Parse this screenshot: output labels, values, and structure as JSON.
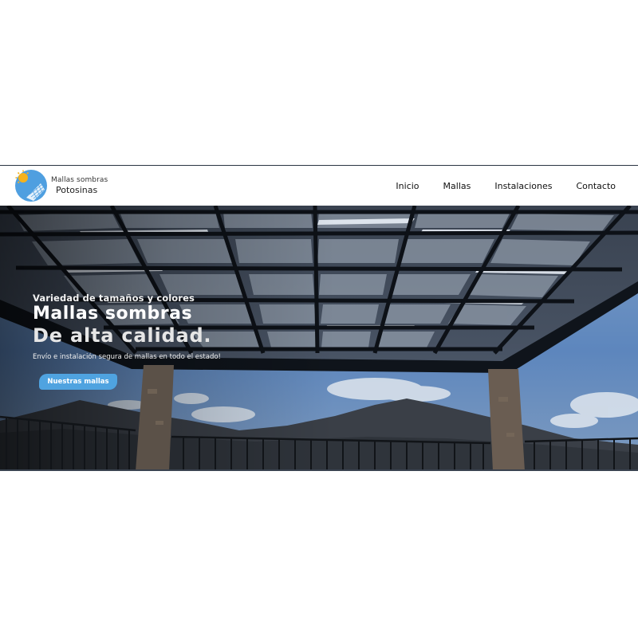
{
  "brand": {
    "line1": "Mallas sombras",
    "line2": "Potosinas",
    "logo_icon": "sun-shade-logo-icon",
    "logo_colors": {
      "circle": "#4f9fe0",
      "sun": "#f5b21c",
      "net": "#ffffff"
    }
  },
  "nav": {
    "items": [
      {
        "label": "Inicio"
      },
      {
        "label": "Mallas"
      },
      {
        "label": "Instalaciones"
      },
      {
        "label": "Contacto"
      }
    ]
  },
  "hero": {
    "eyebrow": "Variedad de tamaños y colores",
    "title_line1": "Mallas sombras",
    "title_line2": "De alta calidad.",
    "subtitle": "Envío e instalación segura de mallas en todo el estado!",
    "cta_label": "Nuestras mallas",
    "image_description_icon": "shade-pergola-photo",
    "accent_color": "#4fa3e0"
  }
}
